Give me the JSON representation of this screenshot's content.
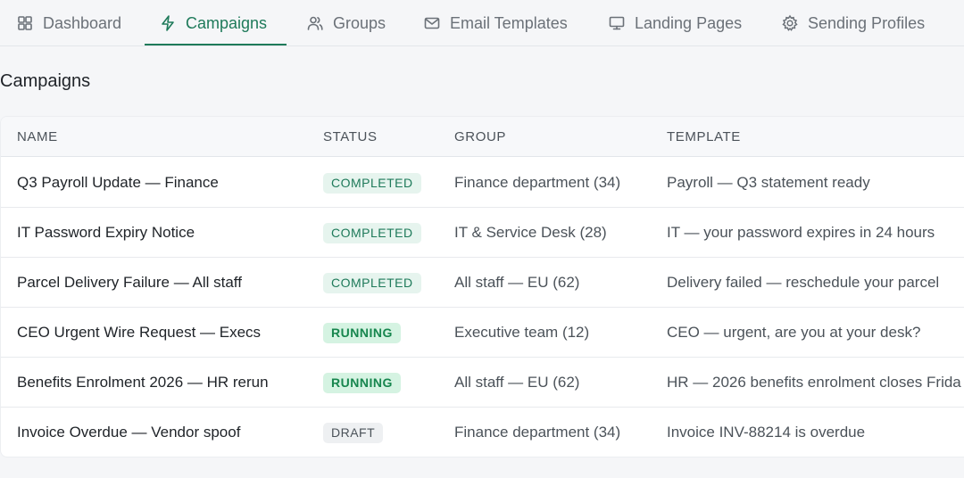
{
  "nav": {
    "tabs": [
      {
        "label": "Dashboard",
        "icon": "grid-icon",
        "active": false
      },
      {
        "label": "Campaigns",
        "icon": "bolt-icon",
        "active": true
      },
      {
        "label": "Groups",
        "icon": "users-icon",
        "active": false
      },
      {
        "label": "Email Templates",
        "icon": "envelope-icon",
        "active": false
      },
      {
        "label": "Landing Pages",
        "icon": "monitor-icon",
        "active": false
      },
      {
        "label": "Sending Profiles",
        "icon": "gear-icon",
        "active": false
      }
    ]
  },
  "page": {
    "title": "Campaigns"
  },
  "table": {
    "headers": {
      "name": "NAME",
      "status": "STATUS",
      "group": "GROUP",
      "template": "TEMPLATE"
    },
    "rows": [
      {
        "name": "Q3 Payroll Update — Finance",
        "status": "COMPLETED",
        "group": "Finance department (34)",
        "template": "Payroll — Q3 statement ready"
      },
      {
        "name": "IT Password Expiry Notice",
        "status": "COMPLETED",
        "group": "IT & Service Desk (28)",
        "template": "IT — your password expires in 24 hours"
      },
      {
        "name": "Parcel Delivery Failure — All staff",
        "status": "COMPLETED",
        "group": "All staff — EU (62)",
        "template": "Delivery failed — reschedule your parcel"
      },
      {
        "name": "CEO Urgent Wire Request — Execs",
        "status": "RUNNING",
        "group": "Executive team (12)",
        "template": "CEO — urgent, are you at your desk?"
      },
      {
        "name": "Benefits Enrolment 2026 — HR rerun",
        "status": "RUNNING",
        "group": "All staff — EU (62)",
        "template": "HR — 2026 benefits enrolment closes Frida"
      },
      {
        "name": "Invoice Overdue — Vendor spoof",
        "status": "DRAFT",
        "group": "Finance department (34)",
        "template": "Invoice INV-88214 is overdue"
      }
    ]
  },
  "colors": {
    "accent": "#1e7a5a",
    "completed_bg": "#e6f4ee",
    "running_bg": "#d5f3e2",
    "draft_bg": "#eef0f2"
  }
}
